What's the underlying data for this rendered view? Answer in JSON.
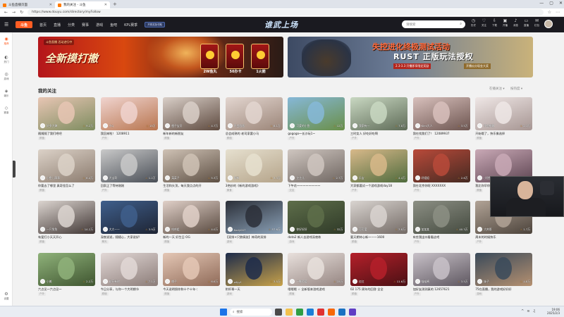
{
  "browser": {
    "tabs": [
      {
        "title": "斗鱼直播页面",
        "active": false
      },
      {
        "title": "我的关注 - 斗鱼",
        "active": true
      }
    ],
    "url": "https://www.douyu.com/directory/myFollow",
    "window_controls": [
      "—",
      "▢",
      "✕"
    ]
  },
  "site": {
    "logo": "斗鱼",
    "nav": [
      "首页",
      "直播",
      "分类",
      "赛事",
      "游戏",
      "鱼吧",
      "KPL赛季"
    ],
    "promo_badge": "开赛奖励领取",
    "center_title": "谁武上场",
    "search_placeholder": "请搜索",
    "header_icons": [
      "历史",
      "关注",
      "下载",
      "开播",
      "消息",
      "直播",
      "红包"
    ]
  },
  "rail": [
    {
      "icon": "◉",
      "label": "推荐",
      "active": true
    },
    {
      "icon": "◐",
      "label": "热门",
      "active": false
    },
    {
      "icon": "◎",
      "label": "游戏",
      "active": false
    },
    {
      "icon": "◈",
      "label": "娱乐",
      "active": false
    },
    {
      "icon": "◇",
      "label": "赛事",
      "active": false
    },
    {
      "icon": "⚙",
      "label": "设置",
      "active": false
    }
  ],
  "banners": {
    "left": {
      "tag": "斗鱼直播 活动进行中",
      "title": "全新摸打撤",
      "prizes": [
        "2W鱼丸",
        "50办卡",
        "1火箭"
      ]
    },
    "right": {
      "title": "失控进化终极测试活动",
      "subtitle": "RUST 正版玩法授权",
      "note1": "2.3-3.3 开播即享限定奖励",
      "note2": "开播瓜分现金大奖"
    }
  },
  "section": {
    "title": "我的关注",
    "filter_sort": "在播关注 ▾",
    "filter_view": "按热度 ▾"
  },
  "cards": [
    {
      "title": "随随随了我们吧吧",
      "anchor": "好多大婶",
      "viewers": "9.2万",
      "tag": "颜值",
      "colors": [
        "#e8c6b4",
        "#7d8c5f"
      ]
    },
    {
      "title": "我回来啦！ 1208911",
      "anchor": "小Q",
      "viewers": "15万",
      "tag": "户外",
      "colors": [
        "#f0d4cf",
        "#b8754f"
      ]
    },
    {
      "title": "新年新的新朋友",
      "anchor": "橙子宝贝",
      "viewers": "4.7万",
      "tag": "颜值",
      "colors": [
        "#d9cfc8",
        "#5e4a3f"
      ]
    },
    {
      "title": "总会成熟的 老司家要小马",
      "anchor": "不会画画",
      "viewers": "8.1万",
      "tag": "颜值",
      "colors": [
        "#e3d6d0",
        "#9b8578"
      ]
    },
    {
      "title": "gogogo～长沙玩1~",
      "anchor": "可爱的小鱼",
      "viewers": "12万",
      "tag": "户外",
      "colors": [
        "#86b8d8",
        "#6a8f48"
      ]
    },
    {
      "title": "三时女人 好吃好吃啊",
      "anchor": "我家有一",
      "viewers": "7.8万",
      "tag": "户外",
      "colors": [
        "#c9d8c2",
        "#5e6b57"
      ]
    },
    {
      "title": "我在找我们了！ 12089937",
      "anchor": "Kimi大人",
      "viewers": "3.5万",
      "tag": "户外",
      "colors": [
        "#d8c0bc",
        "#6d5550"
      ]
    },
    {
      "title": "开始哦了，快乐像选择",
      "anchor": "不会唱歌",
      "viewers": "2.1万",
      "tag": "颜值",
      "colors": [
        "#efe7e6",
        "#a69592"
      ]
    },
    {
      "title": "你要去了哪里 真奇怪怎么了",
      "anchor": "小鱼儿乖乖",
      "viewers": "6.4万",
      "tag": "颜值",
      "colors": [
        "#dcd2c8",
        "#8b7b6e"
      ]
    },
    {
      "title": "回家正了等待刚刚",
      "anchor": "大宝哥",
      "viewers": "1.2万",
      "tag": "户外",
      "colors": [
        "#c9c9c9",
        "#4a4f57"
      ]
    },
    {
      "title": "生活和头顶，每天我点点的开",
      "anchor": "菜菜子",
      "viewers": "5.3万",
      "tag": "颜值",
      "colors": [
        "#cfc2b5",
        "#5e5044"
      ]
    },
    {
      "title": "3绝妙的《新的游戏游戏》",
      "anchor": "阿布",
      "viewers": "3.3万",
      "tag": "美食",
      "colors": [
        "#e6e0cf",
        "#b5a48a"
      ]
    },
    {
      "title": "下午花～～～～～～～～",
      "anchor": "芷芷儿",
      "viewers": "2.7万",
      "tag": "交友",
      "colors": [
        "#cfc6c0",
        "#6f6661"
      ]
    },
    {
      "title": "大家都要试一个游戏游戏day18",
      "anchor": "乐宝",
      "viewers": "4.4万",
      "tag": "户外",
      "colors": [
        "#d8b98a",
        "#4f6b3d"
      ]
    },
    {
      "title": "我在北京你呢 XXXXXXX",
      "anchor": "好姐姐",
      "viewers": "2.6万",
      "tag": "户外",
      "colors": [
        "#b94a3a",
        "#452a22"
      ]
    },
    {
      "title": "我比你早你早早",
      "anchor": "小甜甜",
      "viewers": "9.9万",
      "tag": "颜值",
      "colors": [
        "#c9a9b6",
        "#5e4552"
      ]
    },
    {
      "title": "有爱打小天天开心",
      "anchor": "一只兔兔",
      "viewers": "14.2万",
      "tag": "颜值",
      "colors": [
        "#dcd5d0",
        "#403634"
      ]
    },
    {
      "title": "深夜说说，随随心，大家说好!",
      "anchor": "大大一一",
      "viewers": "3.9万",
      "tag": "聊天",
      "colors": [
        "#3f5f8c",
        "#1e2433"
      ]
    },
    {
      "title": "新的一天 好生日 OG",
      "anchor": "哈哈姐",
      "viewers": "4.0万",
      "tag": "颜值",
      "colors": [
        "#e0d0c8",
        "#58493f"
      ]
    },
    {
      "title": "【双排+只狼搞笑】神奇的双排",
      "anchor": "Kody007",
      "viewers": "57.6万",
      "tag": "游戏",
      "colors": [
        "#2b2f38",
        "#8aa0b6"
      ]
    },
    {
      "title": "dota2 新人去游戏深夜练",
      "anchor": "你好好好",
      "viewers": "32万",
      "tag": "游戏",
      "colors": [
        "#5e6e4a",
        "#2f3a28"
      ]
    },
    {
      "title": "要天期待心新～一一1600",
      "anchor": "可可爱",
      "viewers": "3.8万",
      "tag": "颜值",
      "colors": [
        "#d9d4d0",
        "#746b66"
      ]
    },
    {
      "title": "有些我出口看看这吧",
      "anchor": "某某某",
      "viewers": "40.3万",
      "tag": "户外",
      "colors": [
        "#8c8f84",
        "#444a3f"
      ]
    },
    {
      "title": "周末的时候快乐",
      "anchor": "大帅哥",
      "viewers": "1.7万",
      "tag": "户外",
      "colors": [
        "#b1a396",
        "#4c433b"
      ]
    },
    {
      "title": "六点见～六点见～",
      "anchor": "小美",
      "viewers": "2.2万",
      "tag": "户外",
      "colors": [
        "#8fb27a",
        "#3f5530"
      ]
    },
    {
      "title": "今日分享，与你一个大明期节",
      "anchor": "花开有时",
      "viewers": "7.1万",
      "tag": "颜值",
      "colors": [
        "#e2d8d6",
        "#8c7d79"
      ]
    },
    {
      "title": "今天说明照你和十个十年-：",
      "anchor": "桃子",
      "viewers": "6.6万",
      "tag": "颜值",
      "colors": [
        "#e4c7b5",
        "#8f6a58"
      ]
    },
    {
      "title": "附杆哥一天",
      "anchor": "wfyyf",
      "viewers": "3.5万",
      "tag": "游戏",
      "colors": [
        "#1d2b4a",
        "#c8a24a"
      ]
    },
    {
      "title": "哦哦哦 ☆ 全新版本游戏游戏",
      "anchor": "一颗葡萄",
      "viewers": "15万",
      "tag": "颜值",
      "colors": [
        "#e8e0dc",
        "#958581"
      ]
    },
    {
      "title": "02 175 周年的回答 全全",
      "anchor": "红红",
      "viewers": "11.6万",
      "tag": "颜值",
      "colors": [
        "#b5202a",
        "#4a1014"
      ]
    },
    {
      "title": "加好友测测真的 12657621",
      "anchor": "喵喵酱",
      "viewers": "3.5万",
      "tag": "户外",
      "colors": [
        "#c8c1c8",
        "#5e5760"
      ]
    },
    {
      "title": "75在直播，我的游戏好好好",
      "anchor": "妹子",
      "viewers": "4.8万",
      "tag": "游戏",
      "colors": [
        "#3a4a5a",
        "#b59070"
      ]
    }
  ],
  "taskbar": {
    "search_placeholder": "搜索",
    "time": "19:06",
    "date": "2025/2/3"
  }
}
